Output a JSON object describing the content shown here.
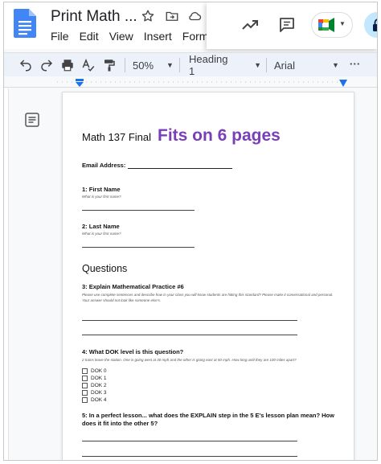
{
  "header": {
    "title": "Print Math ...",
    "menu": [
      "File",
      "Edit",
      "View",
      "Insert",
      "Forma"
    ]
  },
  "toolbar": {
    "zoom": "50%",
    "style": "Heading 1",
    "font": "Arial",
    "more": "⋮"
  },
  "document": {
    "title": "Math 137 Final",
    "badge": "Fits on 6 pages",
    "email_label": "Email Address:",
    "section_heading": "Questions",
    "questions": [
      {
        "label": "1: First Name",
        "hint": "What is your first name?"
      },
      {
        "label": "2: Last Name",
        "hint": "What is your first name?"
      },
      {
        "label": "3: Explain Mathematical Practice #6",
        "hint": "Please use complete sentences and describe how in your class you will know students are hitting this standard? Please make it conversational and personal. Your answer should not look like someone else's."
      },
      {
        "label": "4: What DOK level is this question?",
        "hint": "2 trains leave the station. One is going west at 30 mph and the other is going east at 50 mph. How long until they are 100 miles apart?"
      },
      {
        "label_line1": "5: In a perfect lesson... what does the EXPLAIN step in the 5 E's lesson plan mean? How",
        "label_line2": "does it fit into the other 5?"
      }
    ],
    "dok_options": [
      "DOK 0",
      "DOK 1",
      "DOK 2",
      "DOK 3",
      "DOK 4"
    ]
  },
  "colors": {
    "badge": "#7a3fb8",
    "docs_blue": "#4285f4",
    "toolbar_bg": "#edf2fa",
    "ruler_marker": "#1a73e8"
  }
}
